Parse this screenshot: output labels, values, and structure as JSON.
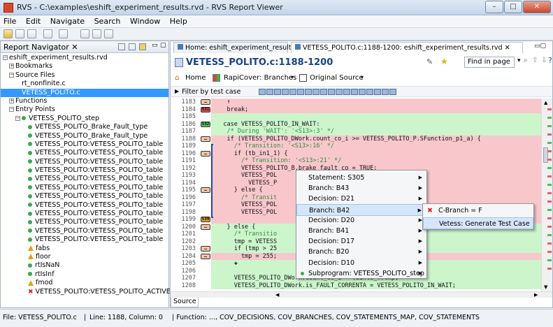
{
  "window": {
    "title": "RVS - C:\\examples\\eshift_experiment_results.rvd - RVS Report Viewer",
    "min": "–",
    "max": "□",
    "close": "✕"
  },
  "menu": [
    "File",
    "Edit",
    "Navigate",
    "Search",
    "Window",
    "Help"
  ],
  "navigator": {
    "title": "Report Navigator ✕",
    "tree": [
      {
        "label": "eshift_experiment_results.rvd",
        "indent": 0,
        "kind": "minus"
      },
      {
        "label": "Bookmarks",
        "indent": 1,
        "kind": "plus"
      },
      {
        "label": "Source Files",
        "indent": 1,
        "kind": "minus"
      },
      {
        "label": "rt_nonfinite.c",
        "indent": 3,
        "kind": "none"
      },
      {
        "label": "VETESS_POLITO.c",
        "indent": 3,
        "kind": "none",
        "selected": true
      },
      {
        "label": "Functions",
        "indent": 1,
        "kind": "plus"
      },
      {
        "label": "Entry Points",
        "indent": 1,
        "kind": "minus"
      },
      {
        "label": "VETESS_POLITO_step",
        "indent": 2,
        "kind": "minusdot"
      },
      {
        "label": "VETESS_POLITO_Brake_Fault_type",
        "indent": 4,
        "kind": "dot"
      },
      {
        "label": "VETESS_POLITO_Brake_Fault_type",
        "indent": 4,
        "kind": "dot"
      },
      {
        "label": "VETESS_POLITO:VETESS_POLITO_table",
        "indent": 4,
        "kind": "dot"
      },
      {
        "label": "VETESS_POLITO:VETESS_POLITO_table",
        "indent": 4,
        "kind": "dot"
      },
      {
        "label": "VETESS_POLITO:VETESS_POLITO_table",
        "indent": 4,
        "kind": "dot"
      },
      {
        "label": "VETESS_POLITO:VETESS_POLITO_table",
        "indent": 4,
        "kind": "dot"
      },
      {
        "label": "VETESS_POLITO:VETESS_POLITO_table",
        "indent": 4,
        "kind": "dot"
      },
      {
        "label": "VETESS_POLITO:VETESS_POLITO_table",
        "indent": 4,
        "kind": "dot"
      },
      {
        "label": "VETESS_POLITO:VETESS_POLITO_table",
        "indent": 4,
        "kind": "dot"
      },
      {
        "label": "VETESS_POLITO:VETESS_POLITO_table",
        "indent": 4,
        "kind": "dot"
      },
      {
        "label": "VETESS_POLITO:VETESS_POLITO_table",
        "indent": 4,
        "kind": "dot"
      },
      {
        "label": "VETESS_POLITO:VETESS_POLITO_table",
        "indent": 4,
        "kind": "dot"
      },
      {
        "label": "VETESS_POLITO:VETESS_POLITO_table",
        "indent": 4,
        "kind": "dot"
      },
      {
        "label": "VETESS_POLITO:VETESS_POLITO_table",
        "indent": 4,
        "kind": "dot"
      },
      {
        "label": "fabs",
        "indent": 4,
        "kind": "warn"
      },
      {
        "label": "floor",
        "indent": 4,
        "kind": "warn"
      },
      {
        "label": "rtIsNaN",
        "indent": 4,
        "kind": "dot"
      },
      {
        "label": "rtIsInf",
        "indent": 4,
        "kind": "dot"
      },
      {
        "label": "fmod",
        "indent": 4,
        "kind": "warn"
      },
      {
        "label": "VETESS_POLITO:VETESS_POLITO_ACTIVE",
        "indent": 4,
        "kind": "x"
      }
    ]
  },
  "tabs": [
    {
      "label": "Home: eshift_experiment_results.rvd",
      "active": false
    },
    {
      "label": "VETESS_POLITO.c:1188-1200: eshift_experiment_results.rvd ✕",
      "active": true
    }
  ],
  "editor": {
    "title": "VETESS_POLITO.c:1188-1200",
    "find_placeholder": "Find in page",
    "home_label": "Home",
    "rapicover_label": "RapiCover: Branches",
    "original_source_label": "Original Source",
    "filter_label": "Filter by test case",
    "source_tab": "Source",
    "lines": [
      {
        "num": "1183",
        "text": "    ↑",
        "bg": "red",
        "hit": "…",
        "hitcolor": "#f3c3a3"
      },
      {
        "num": "1184",
        "text": "    break;",
        "bg": "red",
        "hit": "531",
        "hitcolor": "#e05050"
      },
      {
        "num": "1185",
        "text": "",
        "bg": "green",
        "hit": "",
        "hitcolor": ""
      },
      {
        "num": "1186",
        "text": "   case VETESS_POLITO_IN_WAIT:",
        "bg": "green",
        "hit": "532",
        "hitcolor": "#5ec85e"
      },
      {
        "num": "1187",
        "text": "    /* During 'WAIT': '<S13>:3' */",
        "bg": "green",
        "hit": "",
        "hitcolor": "",
        "comment": true
      },
      {
        "num": "1188",
        "text": "    if (VETESS_POLITO_DWork.count_co_i >= VETESS_POLITO_P.SFunction_p1_a) {",
        "bg": "red",
        "hit": "…",
        "hitcolor": "#f3c3a3"
      },
      {
        "num": "1189",
        "text": "      /* Transition: '<S13>:16' */",
        "bg": "red",
        "hit": "",
        "hitcolor": "",
        "comment": true
      },
      {
        "num": "1190",
        "text": "      if (tb_in1_1) {",
        "bg": "red",
        "hit": "…",
        "hitcolor": "#f3c3a3"
      },
      {
        "num": "1191",
        "text": "        /* Transition: '<S13>:21' */",
        "bg": "red",
        "hit": "",
        "hitcolor": "",
        "comment": true
      },
      {
        "num": "1192",
        "text": "        VETESS_POLITO_B.brake_fault_co = TRUE;",
        "bg": "red",
        "hit": "",
        "hitcolor": ""
      },
      {
        "num": "1193",
        "text": "        VETESS_POL",
        "bg": "red",
        "hit": "",
        "hitcolor": ""
      },
      {
        "num": "1194",
        "text": "          VETESS_P",
        "bg": "red",
        "hit": "",
        "hitcolor": ""
      },
      {
        "num": "1195",
        "text": "      } else {",
        "bg": "red",
        "hit": "…",
        "hitcolor": "#f3c3a3"
      },
      {
        "num": "1196",
        "text": "        /* Transit",
        "bg": "red",
        "hit": "",
        "hitcolor": "",
        "comment": true
      },
      {
        "num": "1197",
        "text": "        VETESS_POL",
        "bg": "red",
        "hit": "",
        "hitcolor": ""
      },
      {
        "num": "1198",
        "text": "        VETESS_POL",
        "bg": "red",
        "hit": "",
        "hitcolor": ""
      },
      {
        "num": "1199",
        "text": "",
        "bg": "red",
        "hit": "539",
        "hitcolor": "#e0a030"
      },
      {
        "num": "1200",
        "text": "    } else {",
        "bg": "green",
        "hit": "…",
        "hitcolor": "#f3c3a3"
      },
      {
        "num": "1201",
        "text": "      /* Transitio",
        "bg": "green",
        "hit": "",
        "hitcolor": "",
        "comment": true
      },
      {
        "num": "1202",
        "text": "      tmp = VETESS",
        "bg": "green",
        "hit": "",
        "hitcolor": ""
      },
      {
        "num": "1203",
        "text": "      if (tmp > 25",
        "bg": "green",
        "hit": "…",
        "hitcolor": "#f3c3a3"
      },
      {
        "num": "1204",
        "text": "        tmp = 255;",
        "bg": "red",
        "hit": "…",
        "hitcolor": "#f3c3a3"
      },
      {
        "num": "1205",
        "text": "      ✚",
        "bg": "green",
        "hit": "",
        "hitcolor": ""
      },
      {
        "num": "1206",
        "text": "",
        "bg": "green",
        "hit": "",
        "hitcolor": ""
      },
      {
        "num": "1207",
        "text": "      VETESS_POLITO_DWork.count_co_i = (uint8_T)tmp;",
        "bg": "green",
        "hit": "",
        "hitcolor": ""
      },
      {
        "num": "1208",
        "text": "      VETESS_POLITO_DWork.is_FAULT_CORRENTA = VETESS_POLITO_IN_WAIT;",
        "bg": "green",
        "hit": "",
        "hitcolor": ""
      }
    ]
  },
  "context_menu": [
    {
      "label": "Statement: S305",
      "arrow": true
    },
    {
      "label": "Branch: B43",
      "arrow": true
    },
    {
      "label": "Decision: D21",
      "arrow": true
    },
    {
      "label": "Branch: B42",
      "arrow": true,
      "highlight": true
    },
    {
      "label": "Decision: D20",
      "arrow": true
    },
    {
      "label": "Branch: B41",
      "arrow": true
    },
    {
      "label": "Decision: D17",
      "arrow": true
    },
    {
      "label": "Branch: B20",
      "arrow": true
    },
    {
      "label": "Decision: D10",
      "arrow": true
    },
    {
      "label": "Subprogram: VETESS_POLITO_step",
      "arrow": true,
      "dot": true
    }
  ],
  "submenu": [
    {
      "label": "C-Branch = F",
      "xmark": true
    },
    {
      "label": "Vetess: Generate Test Case",
      "highlight": true
    }
  ],
  "status": {
    "file": "File: VETESS_POLITO.c",
    "line": "Line: 1188, Column: 0",
    "function": "| Function: ..., COV_DECISIONS, COV_BRANCHES, COV_STATEMENTS_MAP, COV_STATEMENTS"
  },
  "colors": {
    "covered": "#ccf5cc",
    "uncovered": "#f8c7cc",
    "accent": "#15428b",
    "selection": "#3399ff"
  }
}
